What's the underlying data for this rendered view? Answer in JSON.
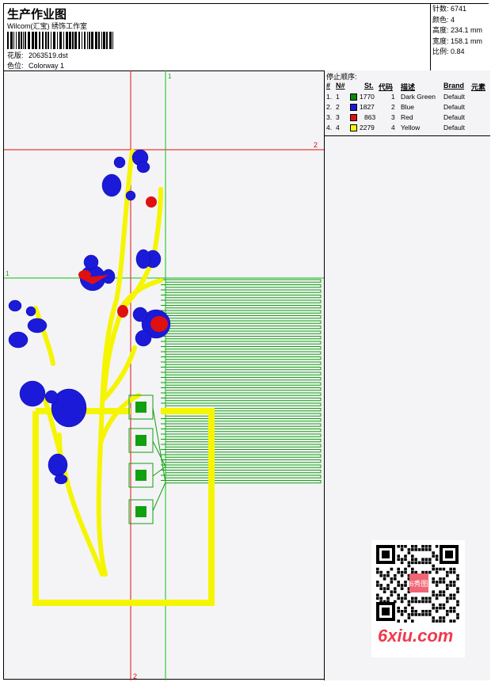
{
  "header": {
    "title": "生产作业图",
    "company": "Wilcom(汇宝) 绣饰工作室",
    "design_label": "花版:",
    "design_value": "2063519.dst",
    "colorway_label": "色位:",
    "colorway_value": "Colorway 1"
  },
  "stats": [
    {
      "label": "针数:",
      "value": "6741"
    },
    {
      "label": "颜色:",
      "value": "4"
    },
    {
      "label": "高度:",
      "value": "234.1 mm"
    },
    {
      "label": "宽度:",
      "value": "158.1 mm"
    },
    {
      "label": "比例:",
      "value": "0.84"
    }
  ],
  "sequence": {
    "title": "停止顺序:",
    "headers": [
      "#",
      "N#",
      "St.",
      "代码",
      "描述",
      "Brand",
      "元素"
    ],
    "rows": [
      {
        "num": "1.",
        "n": "1",
        "color": "#0a8a0a",
        "stitches": "1770",
        "code": "1",
        "desc": "Dark Green",
        "brand": "Default"
      },
      {
        "num": "2.",
        "n": "2",
        "color": "#1a1ad8",
        "stitches": "1827",
        "code": "2",
        "desc": "Blue",
        "brand": "Default"
      },
      {
        "num": "3.",
        "n": "3",
        "color": "#e01010",
        "stitches": "863",
        "code": "3",
        "desc": "Red",
        "brand": "Default"
      },
      {
        "num": "4.",
        "n": "4",
        "color": "#f5f500",
        "stitches": "2279",
        "code": "4",
        "desc": "Yellow",
        "brand": "Default"
      }
    ]
  },
  "guides": {
    "top_label": "1",
    "right_label": "2",
    "left_label": "1",
    "bottom_label": "2"
  },
  "watermark": {
    "brand": "6xiu.com",
    "stamp_text": "6秀图"
  }
}
